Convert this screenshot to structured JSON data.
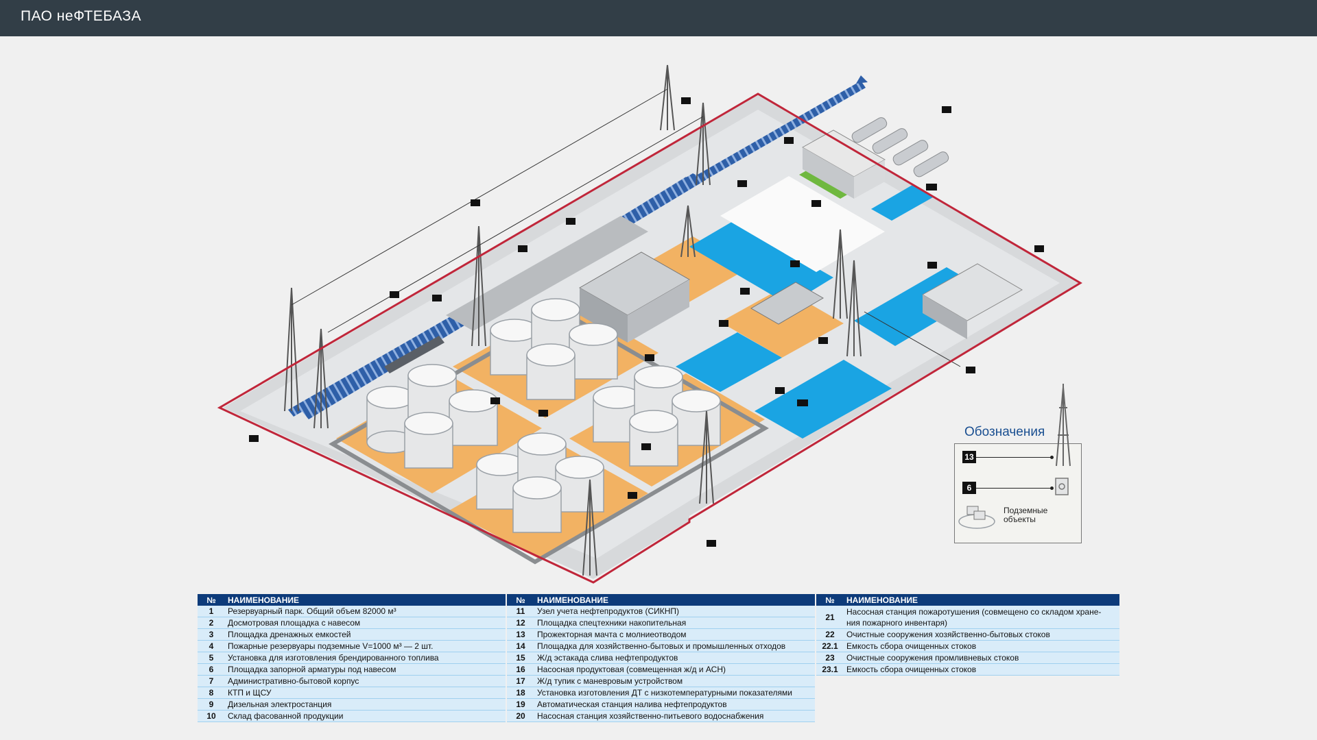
{
  "header": {
    "title": "ПАО неФТЕБАЗА"
  },
  "legend": {
    "title": "Обозначения",
    "items": [
      {
        "badge": "13",
        "icon": "mast-icon"
      },
      {
        "badge": "6",
        "icon": "valve-shed-icon"
      },
      {
        "text_line1": "Подземные",
        "text_line2": "объекты",
        "icon": "underground-object-icon"
      }
    ]
  },
  "table": {
    "col_no": "№",
    "col_name": "НАИМЕНОВАНИЕ",
    "col1": [
      {
        "no": "1",
        "name": "Резервуарный парк. Общий объем 82000 м³"
      },
      {
        "no": "2",
        "name": "Досмотровая площадка с навесом"
      },
      {
        "no": "3",
        "name": "Площадка дренажных емкостей"
      },
      {
        "no": "4",
        "name": "Пожарные резервуары подземные V=1000 м³ — 2 шт."
      },
      {
        "no": "5",
        "name": "Установка для изготовления брендированного топлива"
      },
      {
        "no": "6",
        "name": "Площадка запорной арматуры под навесом"
      },
      {
        "no": "7",
        "name": "Административно-бытовой корпус"
      },
      {
        "no": "8",
        "name": "КТП и ЩСУ"
      },
      {
        "no": "9",
        "name": "Дизельная электростанция"
      },
      {
        "no": "10",
        "name": "Склад фасованной продукции"
      }
    ],
    "col2": [
      {
        "no": "11",
        "name": "Узел учета нефтепродуктов (СИКНП)"
      },
      {
        "no": "12",
        "name": "Площадка спецтехники накопительная"
      },
      {
        "no": "13",
        "name": "Прожекторная мачта с молниеотводом"
      },
      {
        "no": "14",
        "name": "Площадка для хозяйственно-бытовых и промышленных отходов"
      },
      {
        "no": "15",
        "name": "Ж/д эстакада слива нефтепродуктов"
      },
      {
        "no": "16",
        "name": "Насосная продуктовая (совмещенная ж/д и АСН)"
      },
      {
        "no": "17",
        "name": "Ж/д тупик с маневровым устройством"
      },
      {
        "no": "18",
        "name": "Установка изготовления ДТ с низкотемпературными показателями"
      },
      {
        "no": "19",
        "name": "Автоматическая станция налива нефтепродуктов"
      },
      {
        "no": "20",
        "name": "Насосная станция хозяйственно-питьевого водоснабжения"
      }
    ],
    "col3": [
      {
        "no": "21",
        "name": "Насосная станция пожаротушения (совмещено со складом хране-",
        "name2": "ния пожарного инвентаря)"
      },
      {
        "no": "22",
        "name": "Очистные сооружения хозяйственно-бытовых стоков"
      },
      {
        "no": "22.1",
        "name": "Емкость сбора очищенных стоков"
      },
      {
        "no": "23",
        "name": "Очистные сооружения промливневых стоков"
      },
      {
        "no": "23.1",
        "name": "Емкость сбора очищенных стоков"
      }
    ]
  },
  "colors": {
    "header_bg": "#323e47",
    "boundary": "#c0263a",
    "tank_zone": "#f2b263",
    "water_zone": "#1aa4e3",
    "railway": "#2e5fa8",
    "table_header": "#0d3b7a",
    "table_row": "#d9ecf9"
  }
}
